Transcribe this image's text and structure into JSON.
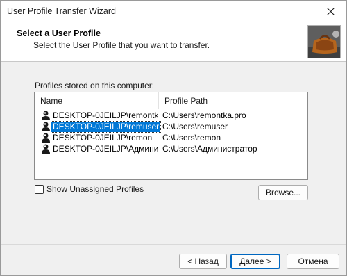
{
  "window": {
    "title": "User Profile Transfer Wizard"
  },
  "header": {
    "title": "Select a User Profile",
    "subtitle": "Select the User Profile that you want to transfer."
  },
  "profiles_caption": "Profiles stored on this computer:",
  "columns": {
    "name": "Name",
    "path": "Profile Path"
  },
  "profiles": [
    {
      "name": "DESKTOP-0JEILJP\\remontka...",
      "path": "C:\\Users\\remontka.pro",
      "selected": false
    },
    {
      "name": "DESKTOP-0JEILJP\\remuser",
      "path": "C:\\Users\\remuser",
      "selected": true
    },
    {
      "name": "DESKTOP-0JEILJP\\remon",
      "path": "C:\\Users\\remon",
      "selected": false
    },
    {
      "name": "DESKTOP-0JEILJP\\Админи...",
      "path": "C:\\Users\\Администратор",
      "selected": false
    }
  ],
  "show_unassigned": {
    "label": "Show Unassigned Profiles",
    "checked": false
  },
  "buttons": {
    "browse": "Browse...",
    "back": "< Назад",
    "next": "Далее >",
    "cancel": "Отмена"
  },
  "icons": {
    "close": "close-icon",
    "profile": "user-profile-icon",
    "header_image": "briefcase-image"
  },
  "colors": {
    "selection": "#0078d7",
    "default_button_border": "#0067c0"
  }
}
